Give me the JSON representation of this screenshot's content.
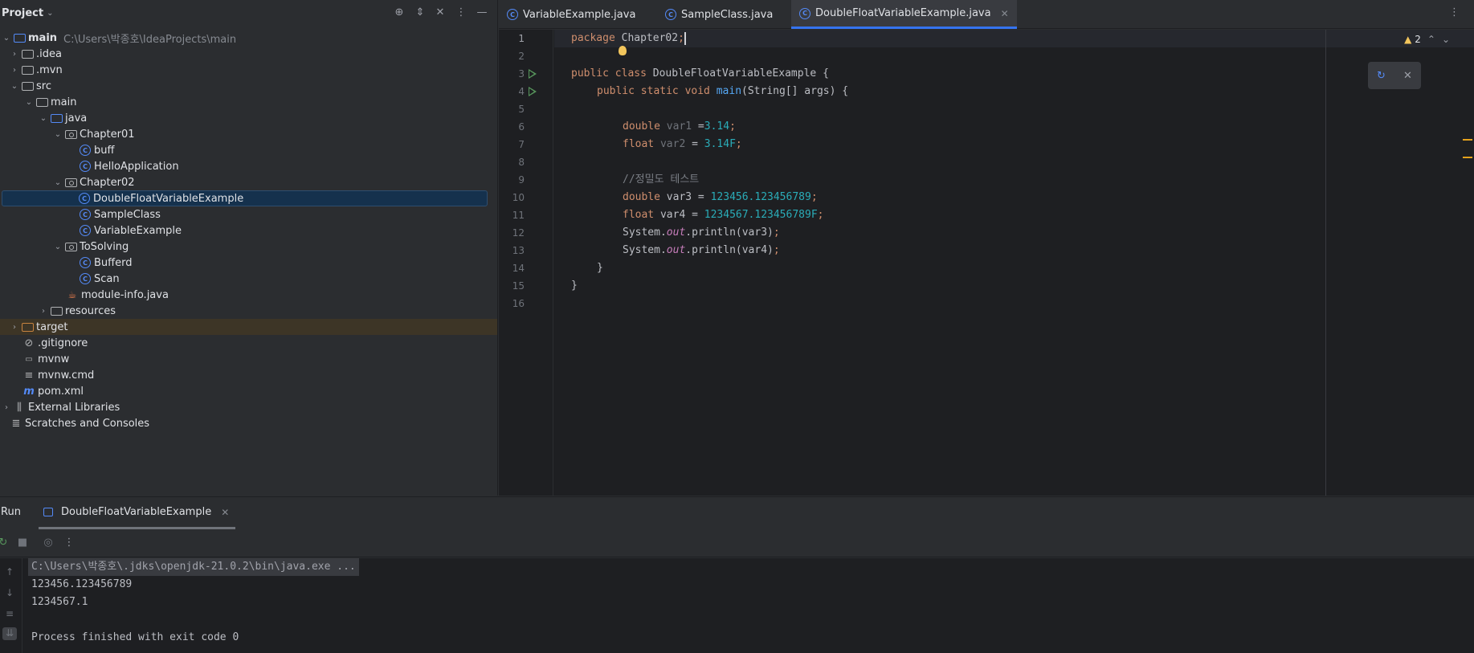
{
  "project": {
    "title": "Project",
    "icons": [
      "locate-icon",
      "expand-icon",
      "collapse-icon",
      "more-icon",
      "hide-icon"
    ],
    "root_name": "main",
    "root_path": "C:\\Users\\박종호\\IdeaProjects\\main",
    "items": [
      {
        "label": "main",
        "path": "C:\\Users\\박종호\\IdeaProjects\\main"
      },
      {
        "label": ".idea"
      },
      {
        "label": ".mvn"
      },
      {
        "label": "src"
      },
      {
        "label": "main"
      },
      {
        "label": "java"
      },
      {
        "label": "Chapter01"
      },
      {
        "label": "buff"
      },
      {
        "label": "HelloApplication"
      },
      {
        "label": "Chapter02"
      },
      {
        "label": "DoubleFloatVariableExample"
      },
      {
        "label": "SampleClass"
      },
      {
        "label": "VariableExample"
      },
      {
        "label": "ToSolving"
      },
      {
        "label": "Bufferd"
      },
      {
        "label": "Scan"
      },
      {
        "label": "module-info.java"
      },
      {
        "label": "resources"
      },
      {
        "label": "target"
      },
      {
        "label": ".gitignore"
      },
      {
        "label": "mvnw"
      },
      {
        "label": "mvnw.cmd"
      },
      {
        "label": "pom.xml"
      },
      {
        "label": "External Libraries"
      },
      {
        "label": "Scratches and Consoles"
      }
    ]
  },
  "tabs": [
    {
      "label": "VariableExample.java"
    },
    {
      "label": "SampleClass.java"
    },
    {
      "label": "DoubleFloatVariableExample.java",
      "active": true
    }
  ],
  "editor": {
    "warnings_count": "2",
    "line_numbers": [
      "1",
      "2",
      "3",
      "4",
      "5",
      "6",
      "7",
      "8",
      "9",
      "10",
      "11",
      "12",
      "13",
      "14",
      "15",
      "16"
    ],
    "code": {
      "l1_kw": "package",
      "l1_rest": " Chapter02",
      "l1_semi": ";",
      "l3_kw": "public class",
      "l3_rest": " DoubleFloatVariableExample {",
      "l4_kw": "public static void",
      "l4_fn": "main",
      "l4_rest": "(String[] args) {",
      "l6_kw": "double",
      "l6_var": " var1",
      "l6_eq": " =",
      "l6_num": "3.14",
      "l7_kw": "float",
      "l7_var": " var2",
      "l7_eq": " = ",
      "l7_num": "3.14F",
      "l9_cm": "//정밀도 테스트",
      "l10_kw": "double",
      "l10_rest": " var3 = ",
      "l10_num": "123456.123456789",
      "l11_kw": "float",
      "l11_rest": " var4 = ",
      "l11_num": "1234567.123456789F",
      "l12_a": "System.",
      "l12_out": "out",
      "l12_b": ".println(var3)",
      "l13_a": "System.",
      "l13_out": "out",
      "l13_b": ".println(var4)",
      "semi": ";",
      "l14": "}",
      "l15": "}"
    }
  },
  "run": {
    "title": "Run",
    "tab_label": "DoubleFloatVariableExample",
    "output": [
      "C:\\Users\\박종호\\.jdks\\openjdk-21.0.2\\bin\\java.exe ...",
      "123456.123456789",
      "1234567.1",
      "",
      "Process finished with exit code 0"
    ]
  }
}
